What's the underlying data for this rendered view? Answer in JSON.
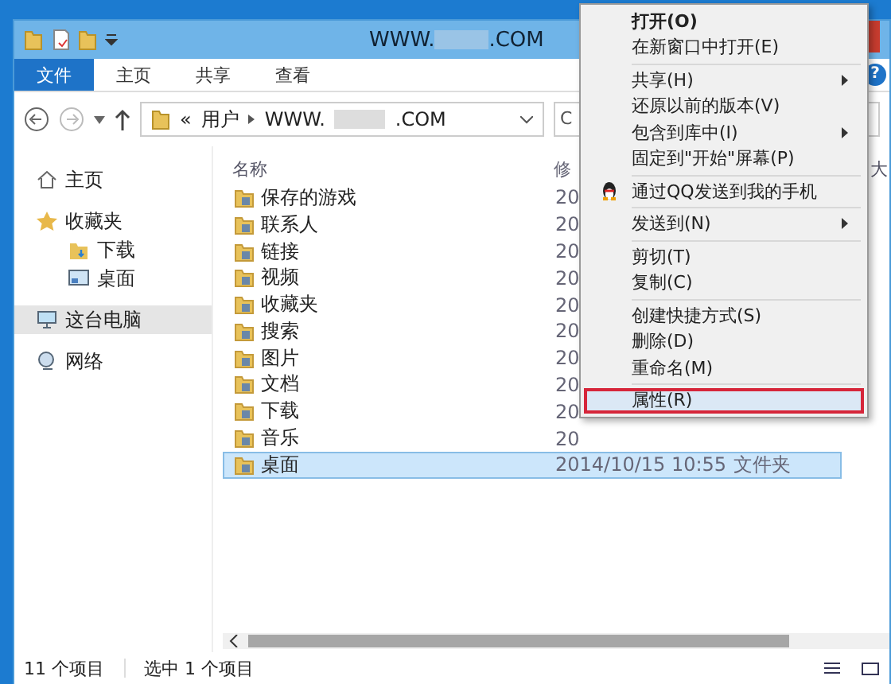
{
  "window": {
    "title_left": "WWW.",
    "title_right": ".COM"
  },
  "help": {
    "label": "?"
  },
  "ribbon_tabs": [
    {
      "label": "文件",
      "selected": true
    },
    {
      "label": "主页",
      "selected": false
    },
    {
      "label": "共享",
      "selected": false
    },
    {
      "label": "查看",
      "selected": false
    }
  ],
  "address": {
    "overflow": "«",
    "segments": [
      "用户",
      "WWW."
    ],
    "tail": ".COM",
    "search_partial": "C"
  },
  "sidebar": {
    "items": [
      {
        "kind": "home",
        "label": "主页",
        "selected": false
      },
      {
        "kind": "star",
        "label": "收藏夹",
        "selected": false,
        "children": [
          {
            "kind": "download",
            "label": "下载",
            "selected": false
          },
          {
            "kind": "desktop",
            "label": "桌面",
            "selected": false
          }
        ]
      },
      {
        "kind": "pc",
        "label": "这台电脑",
        "selected": true
      },
      {
        "kind": "network",
        "label": "网络",
        "selected": false
      }
    ]
  },
  "table": {
    "columns": [
      "名称",
      "修",
      "大"
    ],
    "rows": [
      {
        "name": "保存的游戏",
        "date": "20",
        "selected": false
      },
      {
        "name": "联系人",
        "date": "20",
        "selected": false
      },
      {
        "name": "链接",
        "date": "20",
        "selected": false
      },
      {
        "name": "视频",
        "date": "20",
        "selected": false
      },
      {
        "name": "收藏夹",
        "date": "20",
        "selected": false
      },
      {
        "name": "搜索",
        "date": "20",
        "selected": false
      },
      {
        "name": "图片",
        "date": "20",
        "selected": false
      },
      {
        "name": "文档",
        "date": "20",
        "selected": false
      },
      {
        "name": "下载",
        "date": "20",
        "selected": false
      },
      {
        "name": "音乐",
        "date": "20",
        "selected": false
      },
      {
        "name": "桌面",
        "date": "2014/10/15 10:55",
        "type": "文件夹",
        "selected": true
      }
    ]
  },
  "context_menu": [
    {
      "kind": "item",
      "label": "打开(O)",
      "default": true,
      "submenu": false,
      "selected": false
    },
    {
      "kind": "item",
      "label": "在新窗口中打开(E)",
      "default": false,
      "submenu": false,
      "selected": false
    },
    {
      "kind": "separator"
    },
    {
      "kind": "item",
      "label": "共享(H)",
      "default": false,
      "submenu": true,
      "selected": false
    },
    {
      "kind": "item",
      "label": "还原以前的版本(V)",
      "default": false,
      "submenu": false,
      "selected": false
    },
    {
      "kind": "item",
      "label": "包含到库中(I)",
      "default": false,
      "submenu": true,
      "selected": false
    },
    {
      "kind": "item",
      "label": "固定到\"开始\"屏幕(P)",
      "default": false,
      "submenu": false,
      "selected": false
    },
    {
      "kind": "separator"
    },
    {
      "kind": "icon-item",
      "label": "通过QQ发送到我的手机",
      "default": false,
      "submenu": false,
      "selected": false
    },
    {
      "kind": "separator"
    },
    {
      "kind": "item",
      "label": "发送到(N)",
      "default": false,
      "submenu": true,
      "selected": false
    },
    {
      "kind": "separator"
    },
    {
      "kind": "item",
      "label": "剪切(T)",
      "default": false,
      "submenu": false,
      "selected": false
    },
    {
      "kind": "item",
      "label": "复制(C)",
      "default": false,
      "submenu": false,
      "selected": false
    },
    {
      "kind": "separator"
    },
    {
      "kind": "item",
      "label": "创建快捷方式(S)",
      "default": false,
      "submenu": false,
      "selected": false
    },
    {
      "kind": "item",
      "label": "删除(D)",
      "default": false,
      "submenu": false,
      "selected": false
    },
    {
      "kind": "item",
      "label": "重命名(M)",
      "default": false,
      "submenu": false,
      "selected": false
    },
    {
      "kind": "separator"
    },
    {
      "kind": "item",
      "label": "属性(R)",
      "default": false,
      "submenu": false,
      "selected": true
    }
  ],
  "status_bar": {
    "count": "11 个项目",
    "selection": "选中 1 个项目"
  }
}
